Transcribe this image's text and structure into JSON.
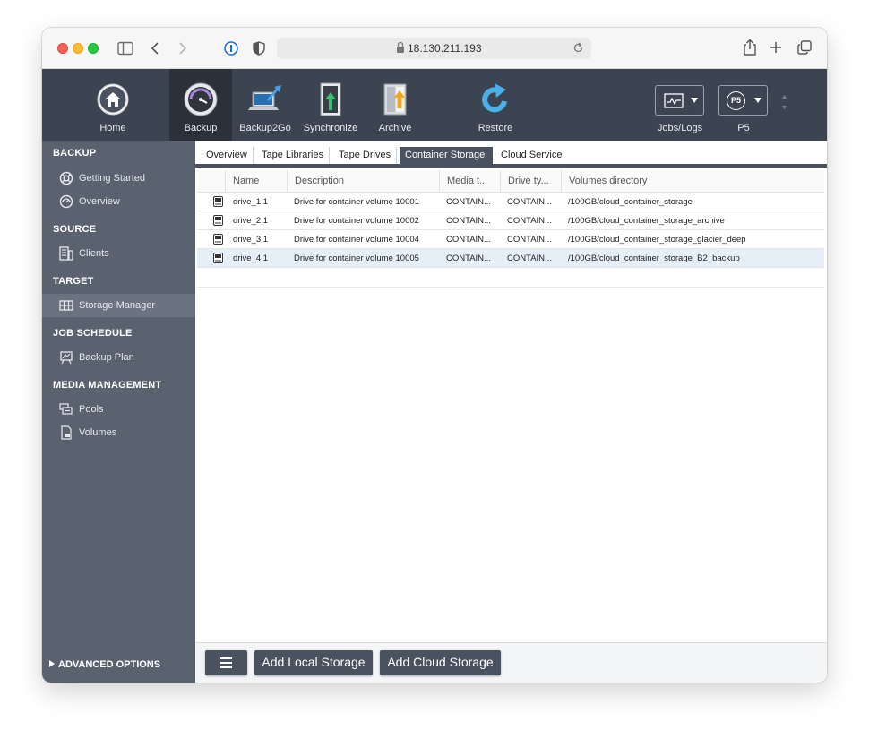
{
  "browser": {
    "url": "18.130.211.193"
  },
  "toolbar": {
    "home": "Home",
    "backup": "Backup",
    "backup2go": "Backup2Go",
    "synchronize": "Synchronize",
    "archive": "Archive",
    "restore": "Restore",
    "jobs_logs": "Jobs/Logs",
    "p5": "P5",
    "p5_badge": "P5"
  },
  "sidebar": {
    "sections": [
      {
        "title": "BACKUP",
        "items": [
          "Getting Started",
          "Overview"
        ]
      },
      {
        "title": "SOURCE",
        "items": [
          "Clients"
        ]
      },
      {
        "title": "TARGET",
        "items": [
          "Storage Manager"
        ]
      },
      {
        "title": "JOB SCHEDULE",
        "items": [
          "Backup Plan"
        ]
      },
      {
        "title": "MEDIA MANAGEMENT",
        "items": [
          "Pools",
          "Volumes"
        ]
      }
    ],
    "advanced": "ADVANCED OPTIONS",
    "selected": "Storage Manager"
  },
  "tabs": [
    "Overview",
    "Tape Libraries",
    "Tape Drives",
    "Container Storage",
    "Cloud Service"
  ],
  "active_tab": "Container Storage",
  "table": {
    "columns": [
      "Name",
      "Description",
      "Media t...",
      "Drive ty...",
      "Volumes directory"
    ],
    "rows": [
      {
        "name": "drive_1.1",
        "description": "Drive for container volume 10001",
        "media": "CONTAIN...",
        "drive": "CONTAIN...",
        "dir": "/100GB/cloud_container_storage"
      },
      {
        "name": "drive_2.1",
        "description": "Drive for container volume 10002",
        "media": "CONTAIN...",
        "drive": "CONTAIN...",
        "dir": "/100GB/cloud_container_storage_archive"
      },
      {
        "name": "drive_3.1",
        "description": "Drive for container volume 10004",
        "media": "CONTAIN...",
        "drive": "CONTAIN...",
        "dir": "/100GB/cloud_container_storage_glacier_deep"
      },
      {
        "name": "drive_4.1",
        "description": "Drive for container volume 10005",
        "media": "CONTAIN...",
        "drive": "CONTAIN...",
        "dir": "/100GB/cloud_container_storage_B2_backup"
      }
    ],
    "highlighted_row": 3
  },
  "footer": {
    "add_local": "Add Local Storage",
    "add_cloud": "Add Cloud Storage"
  },
  "colors": {
    "header_bg": "#3d4451",
    "sidebar_bg": "#5a6270",
    "accent": "#4a5260",
    "row_highlight": "#e6eef8"
  }
}
